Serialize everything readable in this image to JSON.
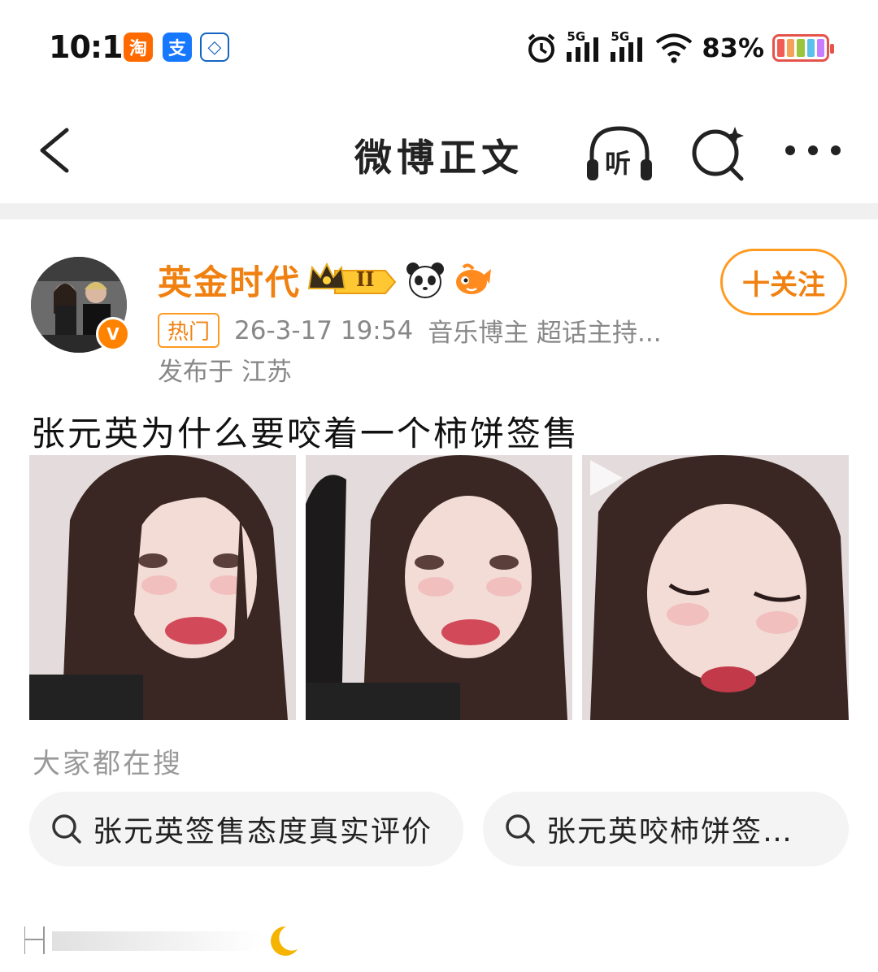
{
  "status_bar": {
    "time": "10:14",
    "app_badges": [
      {
        "name": "taobao-icon",
        "glyph": "淘",
        "color": "#ff6a00"
      },
      {
        "name": "alipay-icon",
        "glyph": "支",
        "color": "#1677ff"
      },
      {
        "name": "bank-icon",
        "glyph": "◇",
        "color": "#1565c0"
      }
    ],
    "network_1": "5G",
    "network_2": "5G",
    "battery_percent": "83%",
    "battery_level": 0.83
  },
  "nav": {
    "title": "微博正文",
    "listen_label": "听"
  },
  "post": {
    "username": "英金时代",
    "level_badge": "II",
    "hot_tag": "热门",
    "timestamp": "26-3-17 19:54",
    "author_tags": "音乐博主 超话主持...",
    "location": "发布于 江苏",
    "verify_glyph": "V",
    "follow_label": "十关注",
    "text": "张元英为什么要咬着一个柿饼签售",
    "photos": [
      {
        "name": "photo-1",
        "has_video": false
      },
      {
        "name": "photo-2",
        "has_video": false
      },
      {
        "name": "photo-3",
        "has_video": true
      }
    ]
  },
  "search": {
    "heading": "大家都在搜",
    "chips": [
      "张元英签售态度真实评价",
      "张元英咬柿饼签…"
    ]
  },
  "colors": {
    "accent_orange": "#f08010",
    "meta_gray": "#888888",
    "chip_bg": "#f4f4f4"
  }
}
